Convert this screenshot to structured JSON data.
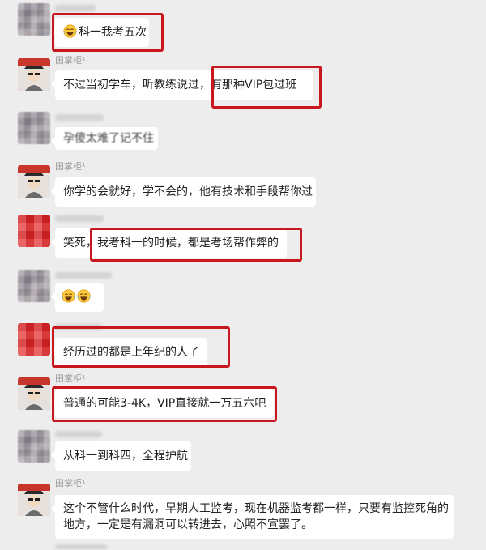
{
  "messages": [
    {
      "sender": "",
      "text": "科一我考五次",
      "emoji_prefix": "laugh-cry-emoji"
    },
    {
      "sender": "田掌柜¹",
      "text": "不过当初学车，听教练说过，有那种VIP包过班"
    },
    {
      "sender": "",
      "text": "孕傻太难了记不住"
    },
    {
      "sender": "田掌柜¹",
      "text": "你学的会就好，学不会的，他有技术和手段帮你过"
    },
    {
      "sender": "",
      "text": "笑死，我考科一的时候，都是考场帮作弊的"
    },
    {
      "sender": "",
      "text": "",
      "emojis": [
        "laugh-cry-emoji",
        "laugh-cry-emoji"
      ]
    },
    {
      "sender": "",
      "text": "经历过的都是上年纪的人了"
    },
    {
      "sender": "田掌柜¹",
      "text": "普通的可能3-4K，VIP直接就一万五六吧"
    },
    {
      "sender": "",
      "text": "从科一到科四，全程护航"
    },
    {
      "sender": "田掌柜¹",
      "lines": [
        "这个不管什么时代，早期人工监考，现在机器监考都一样，只要有监控死角的",
        "地方，一定是有漏洞可以转进去，心照不宣罢了。"
      ]
    }
  ],
  "colors": {
    "background": "#ededed",
    "bubble": "#ffffff",
    "highlight": "#c8181e"
  }
}
